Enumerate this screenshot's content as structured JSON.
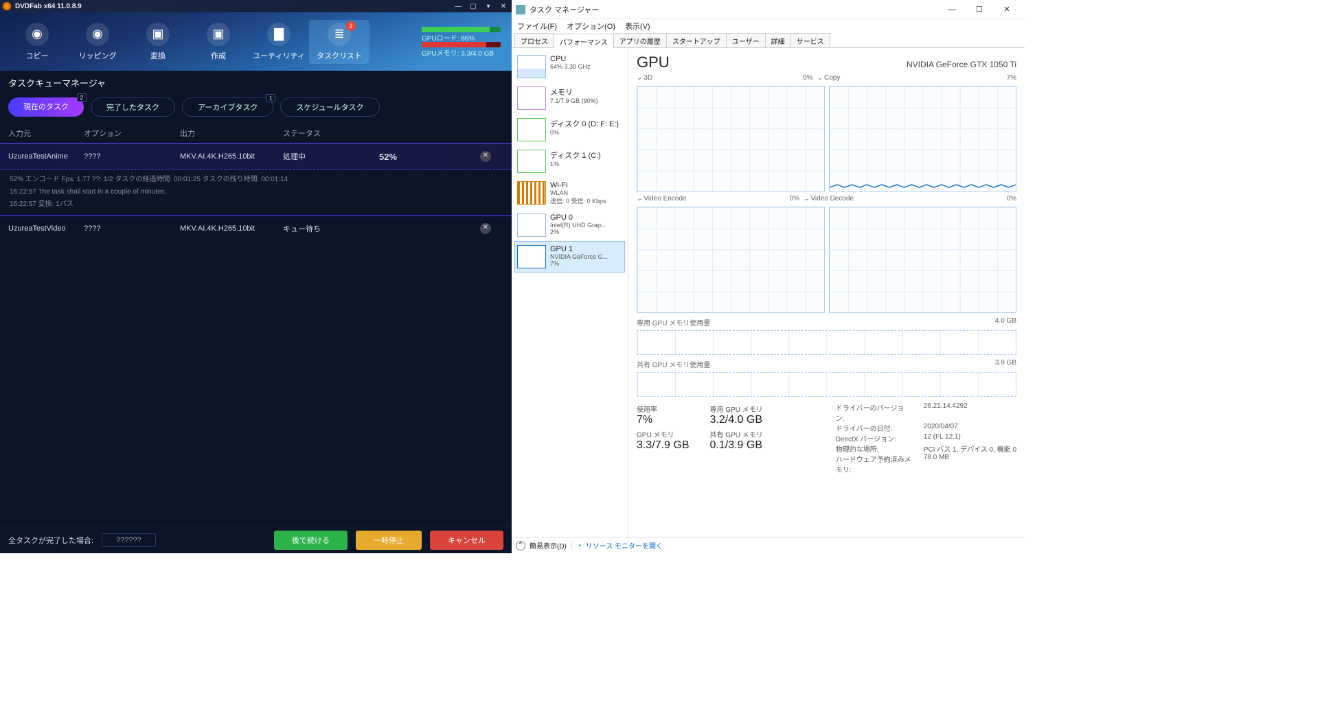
{
  "dvdfab": {
    "title": "DVDFab x64  11.0.8.9",
    "tools": {
      "copy": "コピー",
      "ripping": "リッピング",
      "convert": "変換",
      "create": "作成",
      "utility": "ユーティリティ",
      "tasklist": "タスクリスト",
      "badge": "2"
    },
    "gpu": {
      "load": "GPUロード: 86%",
      "mem": "GPUメモリ: 3.3/4.0 GB"
    },
    "section": "タスクキューマネージャ",
    "tabs": {
      "current": "現在のタスク",
      "current_badge": "2",
      "done": "完了したタスク",
      "archive": "アーカイブタスク",
      "archive_badge": "1",
      "schedule": "スケジュールタスク"
    },
    "cols": {
      "source": "入力元",
      "option": "オプション",
      "output": "出力",
      "status": "ステータス"
    },
    "rows": [
      {
        "src": "UzureaTestAnime",
        "opt": "????",
        "out": "MKV.AI.4K.H265.10bit",
        "status": "処理中",
        "pct": "52%"
      },
      {
        "src": "UzureaTestVideo",
        "opt": "????",
        "out": "MKV.AI.4K.H265.10bit",
        "status": "キュー待ち",
        "pct": ""
      }
    ],
    "log": {
      "l1": "52%  エンコード Fps: 1.77   ??: 1/2  タスクの経過時間: 00:01:25  タスクの残り時間: 00:01:14",
      "l2": "16:22:57    The task shall start in a couple of minutes.",
      "l3": "16:22:57    変換: 1パス"
    },
    "footer": {
      "label": "全タスクが完了した場合:",
      "select": "??????",
      "continue": "後で続ける",
      "pause": "一時停止",
      "cancel": "キャンセル"
    }
  },
  "tm": {
    "title": "タスク マネージャー",
    "menu": {
      "file": "ファイル(F)",
      "options": "オプション(O)",
      "view": "表示(V)"
    },
    "tabs": [
      "プロセス",
      "パフォーマンス",
      "アプリの履歴",
      "スタートアップ",
      "ユーザー",
      "詳細",
      "サービス"
    ],
    "active_tab": 1,
    "side": [
      {
        "name": "CPU",
        "sub": "64%  3.30 GHz"
      },
      {
        "name": "メモリ",
        "sub": "7.1/7.9 GB (90%)"
      },
      {
        "name": "ディスク 0 (D: F: E:)",
        "sub": "0%"
      },
      {
        "name": "ディスク 1 (C:)",
        "sub": "1%"
      },
      {
        "name": "Wi-Fi",
        "sub": "WLAN",
        "sub2": "送信: 0 受信: 0 Kbps"
      },
      {
        "name": "GPU 0",
        "sub": "Intel(R) UHD Grap...",
        "sub2": "2%"
      },
      {
        "name": "GPU 1",
        "sub": "NVIDIA GeForce G...",
        "sub2": "7%"
      }
    ],
    "main": {
      "title": "GPU",
      "device": "NVIDIA GeForce GTX 1050 Ti",
      "charts": {
        "c1": {
          "name": "3D",
          "pct": "0%"
        },
        "c2": {
          "name": "Copy",
          "pct": "7%"
        },
        "c3": {
          "name": "Video Encode",
          "pct": "0%"
        },
        "c4": {
          "name": "Video Decode",
          "pct": "0%"
        }
      },
      "mem1": {
        "label": "専用 GPU メモリ使用量",
        "max": "4.0 GB"
      },
      "mem2": {
        "label": "共有 GPU メモリ使用量",
        "max": "3.9 GB"
      },
      "stats": {
        "usage_k": "使用率",
        "usage_v": "7%",
        "ded_k": "専用 GPU メモリ",
        "ded_v": "3.2/4.0 GB",
        "gpumem_k": "GPU メモリ",
        "gpumem_v": "3.3/7.9 GB",
        "shared_k": "共有 GPU メモリ",
        "shared_v": "0.1/3.9 GB"
      },
      "meta": {
        "drv_ver_k": "ドライバーのバージョン:",
        "drv_ver_v": "26.21.14.4292",
        "drv_date_k": "ドライバーの日付:",
        "drv_date_v": "2020/04/07",
        "dx_k": "DirectX バージョン:",
        "dx_v": "12 (FL 12.1)",
        "loc_k": "物理的な場所:",
        "loc_v": "PCI バス 1, デバイス 0, 機能 0",
        "hw_k": "ハードウェア予約済みメモリ:",
        "hw_v": "78.0 MB"
      }
    },
    "footer": {
      "simple": "簡易表示(D)",
      "resmon": "リソース モニターを開く"
    }
  }
}
